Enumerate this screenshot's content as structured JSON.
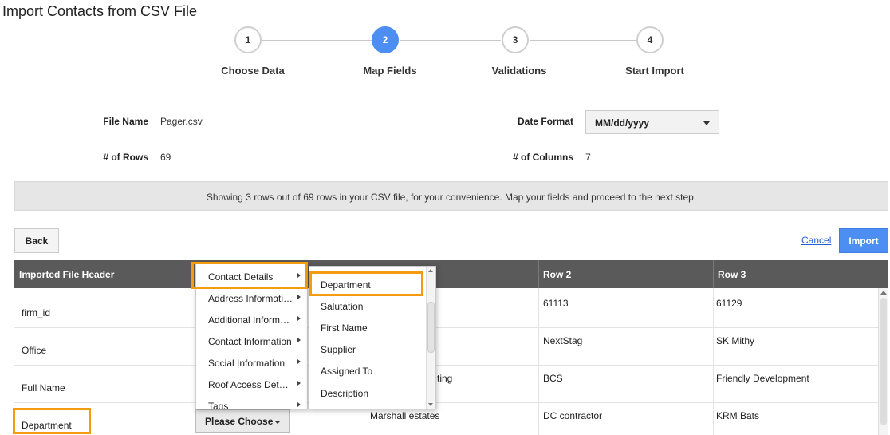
{
  "page": {
    "title": "Import Contacts from CSV File"
  },
  "stepper": {
    "steps": [
      {
        "number": "1",
        "label": "Choose Data"
      },
      {
        "number": "2",
        "label": "Map Fields"
      },
      {
        "number": "3",
        "label": "Validations"
      },
      {
        "number": "4",
        "label": "Start Import"
      }
    ],
    "active_step": 2
  },
  "file_info": {
    "file_name_label": "File Name",
    "file_name": "Pager.csv",
    "rows_label": "# of Rows",
    "rows": "69",
    "date_format_label": "Date Format",
    "date_format": "MM/dd/yyyy",
    "columns_label": "# of Columns",
    "columns": "7"
  },
  "notice": "Showing 3 rows out of 69 rows in your CSV file, for your convenience. Map your fields and proceed to the next step.",
  "actions": {
    "back_label": "Back",
    "cancel_label": "Cancel",
    "import_label": "Import"
  },
  "table": {
    "headers": [
      "Imported File Header",
      "",
      "",
      "Row 2",
      "Row 3"
    ],
    "rows": [
      {
        "header": "firm_id",
        "row1": "",
        "row2": "61113",
        "row3": "61129"
      },
      {
        "header": "Office",
        "row1": "",
        "row2": "NextStag",
        "row3": "SK Mithy"
      },
      {
        "header": "Full Name",
        "row1": "ting",
        "row2": "BCS",
        "row3": "Friendly Development"
      },
      {
        "header": "Department",
        "row1": "Marshall estates",
        "row2": "DC contractor",
        "row3": "KRM Bats"
      }
    ]
  },
  "field_select": {
    "label": "Please Choose"
  },
  "category_menu": {
    "items": [
      "Contact Details",
      "Address Informati…",
      "Additional Inform…",
      "Contact Information",
      "Social Information",
      "Roof Access Det…",
      "Tags"
    ]
  },
  "field_menu": {
    "items": [
      "Department",
      "Salutation",
      "First Name",
      "Supplier",
      "Assigned To",
      "Description"
    ]
  },
  "colors": {
    "accent": "#4d8ef2",
    "highlight": "#f39c12",
    "table_header": "#5a5a5a"
  },
  "icons": {
    "dropdown": "chevron-down-icon",
    "submenu": "chevron-right-icon"
  }
}
